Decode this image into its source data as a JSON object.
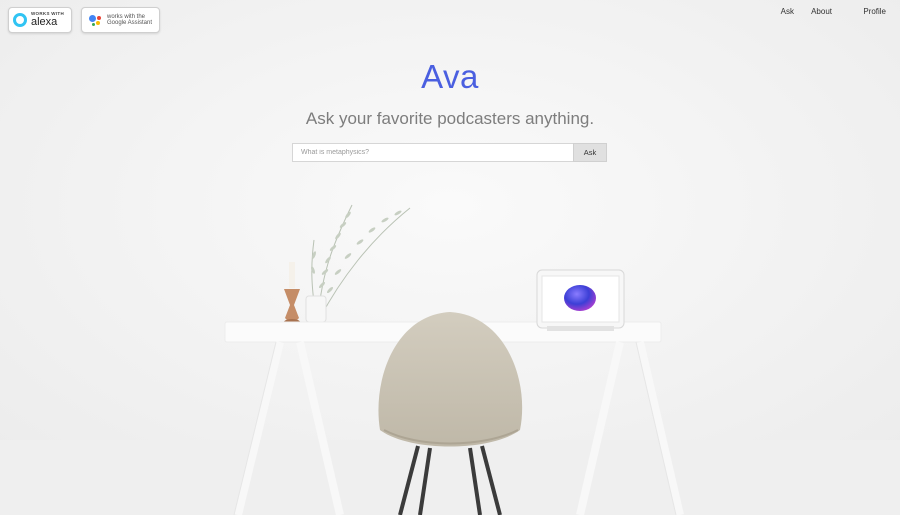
{
  "badges": {
    "alexa": {
      "small": "WORKS WITH",
      "big": "alexa"
    },
    "google": {
      "line1": "works with the",
      "line2": "Google Assistant"
    }
  },
  "nav": {
    "ask": "Ask",
    "about": "About",
    "profile": "Profile"
  },
  "hero": {
    "title": "Ava",
    "subtitle": "Ask your favorite podcasters anything.",
    "search_placeholder": "What is metaphysics?",
    "ask_label": "Ask"
  },
  "colors": {
    "title": "#4a5fe0",
    "background": "#f4f4f4",
    "alexa_ring": "#31c4f3"
  }
}
